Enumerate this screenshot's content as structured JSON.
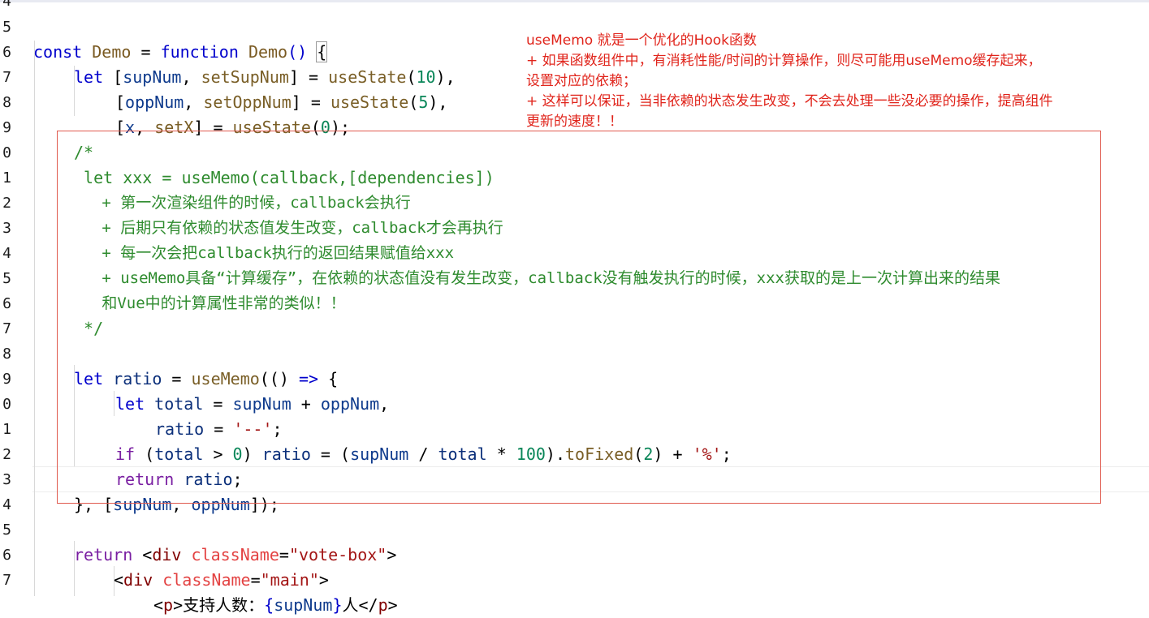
{
  "line_numbers": [
    "4",
    "5",
    "6",
    "7",
    "8",
    "9",
    "0",
    "1",
    "2",
    "3",
    "4",
    "5",
    "6",
    "7",
    "8",
    "9",
    "0",
    "1",
    "2",
    "3",
    "4",
    "5",
    "6",
    "7"
  ],
  "code": {
    "l5": {
      "kw_const": "const",
      "name": "Demo",
      "eq": " = ",
      "kw_function": "function",
      "fname": "Demo",
      "paren": "() ",
      "brace": "{"
    },
    "l6": {
      "kw": "let",
      "open": " [",
      "a": "supNum",
      "comma": ", ",
      "b": "setSupNum",
      "close": "] = ",
      "call": "useState",
      "arg_open": "(",
      "num": "10",
      "arg_close": "),"
    },
    "l7": {
      "open": "[",
      "a": "oppNum",
      "comma": ", ",
      "b": "setOppNum",
      "close": "] = ",
      "call": "useState",
      "arg_open": "(",
      "num": "5",
      "arg_close": "),"
    },
    "l8": {
      "open": "[",
      "a": "x",
      "comma": ", ",
      "b": "setX",
      "close": "] = ",
      "call": "useState",
      "arg_open": "(",
      "num": "0",
      "arg_close": ");"
    },
    "c1": "/*",
    "c2": " let xxx = useMemo(callback,[dependencies])",
    "c3": "   + 第一次渲染组件的时候，callback会执行",
    "c4": "   + 后期只有依赖的状态值发生改变，callback才会再执行",
    "c5": "   + 每一次会把callback执行的返回结果赋值给xxx",
    "c6": "   + useMemo具备“计算缓存”，在依赖的状态值没有发生改变，callback没有触发执行的时候，xxx获取的是上一次计算出来的结果",
    "c7": "   和Vue中的计算属性非常的类似！！",
    "c8": " */",
    "l18": {
      "kw": "let",
      "name": " ratio",
      "eq": " = ",
      "call": "useMemo",
      "rest": "(() ",
      "arrow": "=>",
      "brace": " {"
    },
    "l19": {
      "kw": "let",
      "name": " total",
      "eq": " = ",
      "a": "supNum",
      "plus": " + ",
      "b": "oppNum",
      "end": ","
    },
    "l20": {
      "name": "ratio",
      "eq": " = ",
      "str": "'--'",
      "end": ";"
    },
    "l21": {
      "kw": "if",
      "open": " (",
      "a": "total",
      "gt": " > ",
      "num0": "0",
      "close": ") ",
      "b": "ratio",
      "eq": " = (",
      "c": "supNum",
      "div": " / ",
      "d": "total",
      "mul": " * ",
      "num100": "100",
      "dot": ").",
      "method": "toFixed",
      "arg": "(",
      "num2": "2",
      "argc": ")",
      "plus": " + ",
      "str": "'%'",
      "end": ";"
    },
    "l22": {
      "kw": "return",
      "name": " ratio",
      "end": ";"
    },
    "l23": {
      "close": "}, [",
      "a": "supNum",
      "comma": ", ",
      "b": "oppNum",
      "end": "]);"
    },
    "l25": {
      "kw": "return",
      "lt": " <",
      "tag": "div",
      "attr": " className",
      "eq": "=",
      "str": "\"vote-box\"",
      "gt": ">"
    },
    "l26": {
      "lt": "<",
      "tag": "div",
      "attr": " className",
      "eq": "=",
      "str": "\"main\"",
      "gt": ">"
    },
    "l27": {
      "lt": "<",
      "tag": "p",
      "gt": ">",
      "text": "支持人数：",
      "open": "{",
      "var": "supNum",
      "close": "}",
      "text2": "人",
      "lt2": "</",
      "tag2": "p",
      "gt2": ">"
    }
  },
  "note": {
    "line1": "useMemo 就是一个优化的Hook函数",
    "line2": "+ 如果函数组件中，有消耗性能/时间的计算操作，则尽可能用useMemo缓存起来，",
    "line3": "设置对应的依赖；",
    "line4": "+ 这样可以保证，当非依赖的状态发生改变，不会去处理一些没必要的操作，提高组件",
    "line5": "更新的速度！！"
  },
  "colors": {
    "annotation_red": "#e0241b",
    "highlight_box": "#e05a4e",
    "keyword": "#0000cc",
    "comment": "#2e8b2e",
    "string": "#a31515",
    "number": "#098658"
  }
}
